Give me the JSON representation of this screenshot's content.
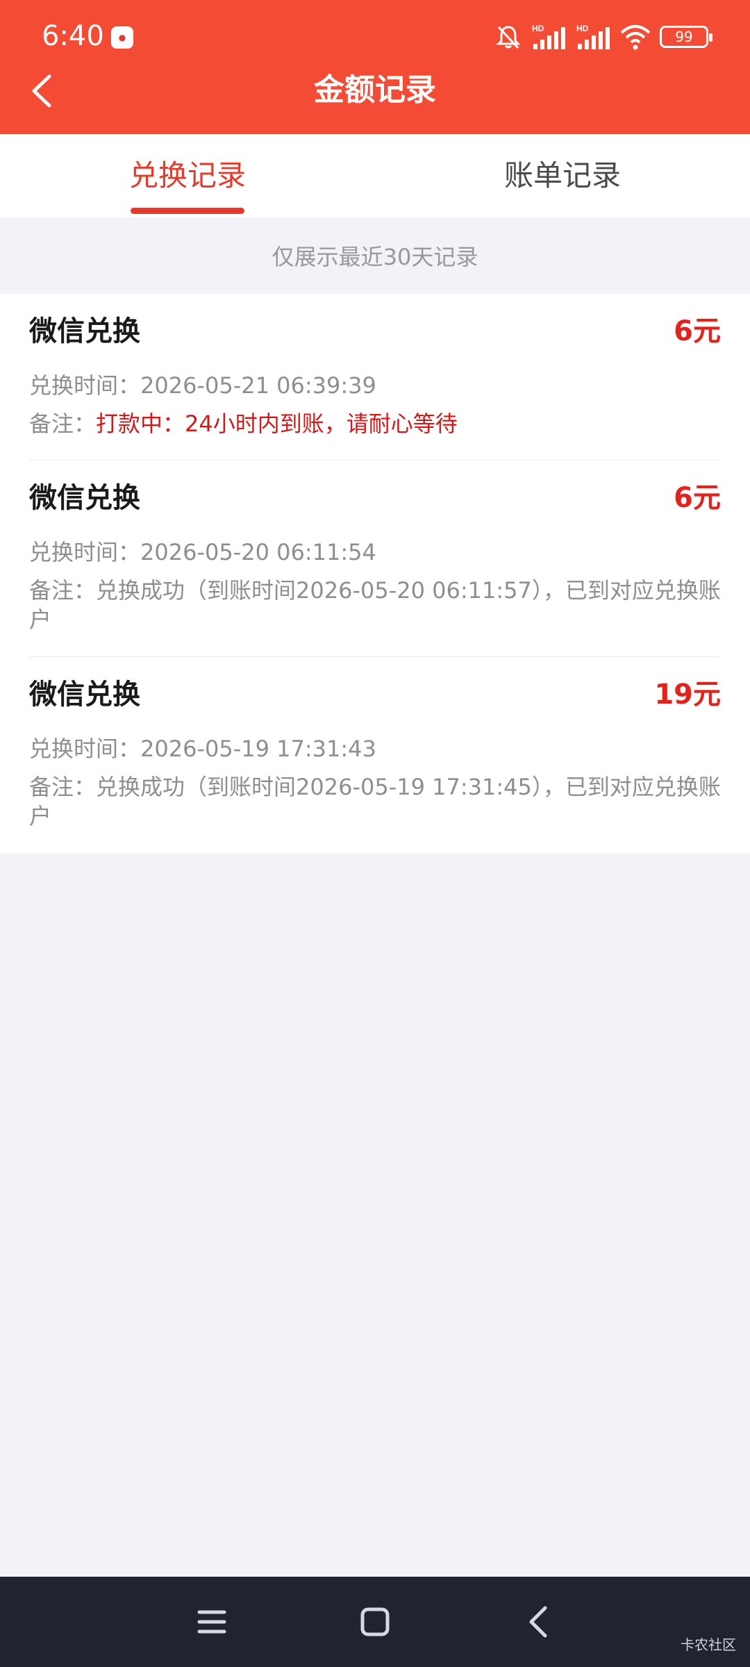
{
  "status_bar": {
    "time": "6:40",
    "battery": "99"
  },
  "header": {
    "title": "金额记录"
  },
  "tabs": [
    {
      "label": "兑换记录",
      "active": true
    },
    {
      "label": "账单记录",
      "active": false
    }
  ],
  "notice": "仅展示最近30天记录",
  "records": [
    {
      "title": "微信兑换",
      "amount": "6元",
      "time": "兑换时间：2026-05-21 06:39:39",
      "note_label": "备注：",
      "note_text": "打款中：24小时内到账，请耐心等待"
    },
    {
      "title": "微信兑换",
      "amount": "6元",
      "time": "兑换时间：2026-05-20 06:11:54",
      "note_label": "备注：",
      "note_text": "兑换成功（到账时间2026-05-20 06:11:57），已到对应兑换账户"
    },
    {
      "title": "微信兑换",
      "amount": "19元",
      "time": "兑换时间：2026-05-19 17:31:43",
      "note_label": "备注：",
      "note_text": "兑换成功（到账时间2026-05-19 17:31:45），已到对应兑换账户"
    }
  ],
  "watermark": "卡农社区",
  "colors": {
    "header_bg": "#f44b35",
    "accent": "#e63a2c",
    "amount": "#e0231c",
    "note_pending": "#d1191c"
  }
}
